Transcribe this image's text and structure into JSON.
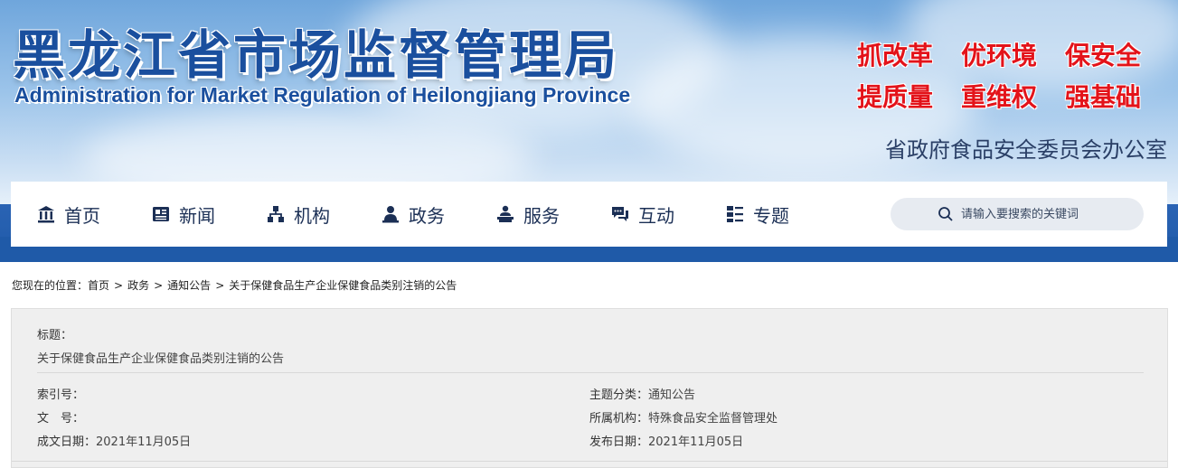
{
  "header": {
    "title": "黑龙江省市场监督管理局",
    "subtitle": "Administration for Market Regulation of Heilongjiang Province",
    "slogans": [
      "抓改革",
      "优环境",
      "保安全",
      "提质量",
      "重维权",
      "强基础"
    ],
    "office": "省政府食品安全委员会办公室"
  },
  "nav": {
    "items": [
      {
        "label": "首页",
        "icon": "home-icon"
      },
      {
        "label": "新闻",
        "icon": "news-icon"
      },
      {
        "label": "机构",
        "icon": "organization-icon"
      },
      {
        "label": "政务",
        "icon": "government-affairs-icon"
      },
      {
        "label": "服务",
        "icon": "service-icon"
      },
      {
        "label": "互动",
        "icon": "interaction-icon"
      },
      {
        "label": "专题",
        "icon": "topics-icon"
      }
    ],
    "search_placeholder": "请输入要搜索的关键词"
  },
  "breadcrumb": {
    "prefix": "您现在的位置：",
    "items": [
      "首页",
      "政务",
      "通知公告",
      "关于保健食品生产企业保健食品类别注销的公告"
    ],
    "separator": ">"
  },
  "info": {
    "title_label": "标题：",
    "title_value": "关于保健食品生产企业保健食品类别注销的公告",
    "index_label": "索引号：",
    "index_value": "",
    "doc_label": "文　号：",
    "doc_value": "",
    "created_label": "成文日期：",
    "created_value": "2021年11月05日",
    "topic_label": "主题分类：",
    "topic_value": "通知公告",
    "org_label": "所属机构：",
    "org_value": "特殊食品安全监督管理处",
    "published_label": "发布日期：",
    "published_value": "2021年11月05日"
  },
  "colors": {
    "brand_blue": "#1a4f9e",
    "band_blue": "#1f5aa8",
    "slogan_red": "#e3131a",
    "nav_text": "#1b2f55",
    "panel_bg": "#efefef"
  }
}
